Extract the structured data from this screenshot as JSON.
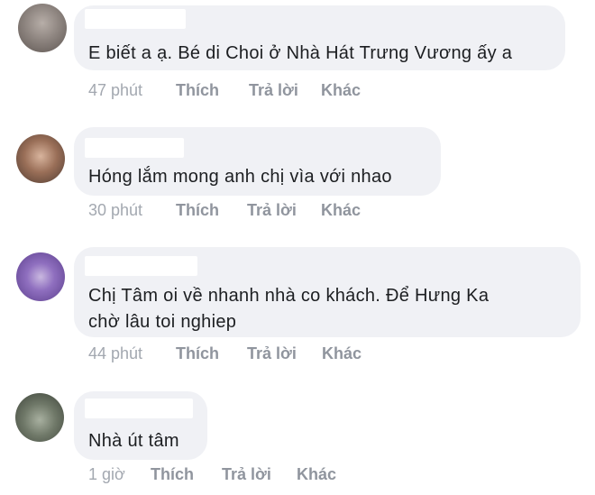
{
  "comments": [
    {
      "text_lines": [
        "E biết a ạ. Bé di Choi ở Nhà Hát Trưng Vương ấy a"
      ],
      "time": "47 phút",
      "like": "Thích",
      "reply": "Trả lời",
      "more": "Khác"
    },
    {
      "text_lines": [
        "Hóng lắm mong anh chị vìa với nhao"
      ],
      "time": "30 phút",
      "like": "Thích",
      "reply": "Trả lời",
      "more": "Khác"
    },
    {
      "text_lines": [
        "Chị Tâm oi về nhanh nhà co khách. Để Hưng Ka",
        "chờ lâu toi nghiep"
      ],
      "time": "44 phút",
      "like": "Thích",
      "reply": "Trả lời",
      "more": "Khác"
    },
    {
      "text_lines": [
        "Nhà út tâm"
      ],
      "time": "1 giờ",
      "like": "Thích",
      "reply": "Trả lời",
      "more": "Khác"
    }
  ],
  "colors": {
    "bubble": "#f0f1f5",
    "text": "#1c1e21",
    "action_link": "#90959e",
    "timestamp": "#a3a8b0"
  }
}
